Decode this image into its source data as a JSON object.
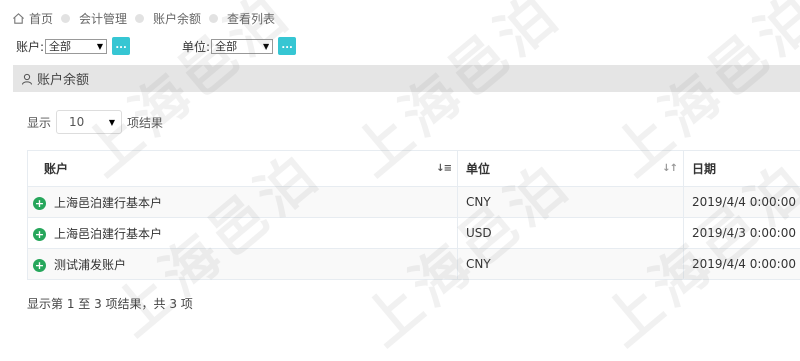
{
  "breadcrumb": {
    "items": [
      "首页",
      "会计管理",
      "账户余额",
      "查看列表"
    ]
  },
  "filters": {
    "account": {
      "label": "账户:",
      "value": "全部",
      "button": "..."
    },
    "unit": {
      "label": "单位:",
      "value": "全部",
      "button": "..."
    }
  },
  "panel": {
    "title": "账户余额",
    "icon": "user-icon"
  },
  "length": {
    "prefix": "显示",
    "value": "10",
    "suffix": "项结果"
  },
  "table": {
    "columns": [
      "账户",
      "单位",
      "日期"
    ],
    "rows": [
      {
        "account": "上海邑泊建行基本户",
        "unit": "CNY",
        "date": "2019/4/4 0:00:00"
      },
      {
        "account": "上海邑泊建行基本户",
        "unit": "USD",
        "date": "2019/4/3 0:00:00"
      },
      {
        "account": "测试浦发账户",
        "unit": "CNY",
        "date": "2019/4/4 0:00:00"
      }
    ]
  },
  "info": "显示第 1 至 3 项结果，共 3 项",
  "watermark": "上海邑泊",
  "colors": {
    "accent": "#36c6d3",
    "expand": "#26a65b",
    "panel_header": "#e5e5e5"
  }
}
